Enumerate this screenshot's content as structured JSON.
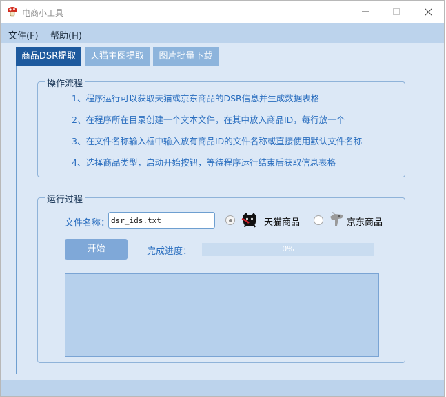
{
  "window": {
    "title": "电商小工具"
  },
  "menu": {
    "file": "文件(F)",
    "help": "帮助(H)"
  },
  "tabs": [
    {
      "label": "商品DSR提取",
      "active": true
    },
    {
      "label": "天猫主图提取",
      "active": false
    },
    {
      "label": "图片批量下载",
      "active": false
    }
  ],
  "process_group": {
    "title": "操作流程",
    "steps": [
      "1、程序运行可以获取天猫或京东商品的DSR信息并生成数据表格",
      "2、在程序所在目录创建一个文本文件，在其中放入商品ID，每行放一个",
      "3、在文件名称输入框中输入放有商品ID的文件名称或直接使用默认文件名称",
      "4、选择商品类型，启动开始按钮，等待程序运行结束后获取信息表格"
    ]
  },
  "run_group": {
    "title": "运行过程",
    "file_label": "文件名称：",
    "file_value": "dsr_ids.txt",
    "radio_tmall": "天猫商品",
    "radio_jd": "京东商品",
    "selected": "tmall",
    "start_label": "开始",
    "progress_label": "完成进度：",
    "progress_value": 0,
    "progress_text": "0%"
  },
  "colors": {
    "accent": "#1e5a9e",
    "tab_inactive": "#8db4dc",
    "text_blue": "#2a6ebf",
    "panel_bg": "#dce8f6"
  },
  "icons": {
    "app": "mushroom-icon",
    "tmall": "tmall-cat-icon",
    "jd": "jd-dog-icon"
  }
}
